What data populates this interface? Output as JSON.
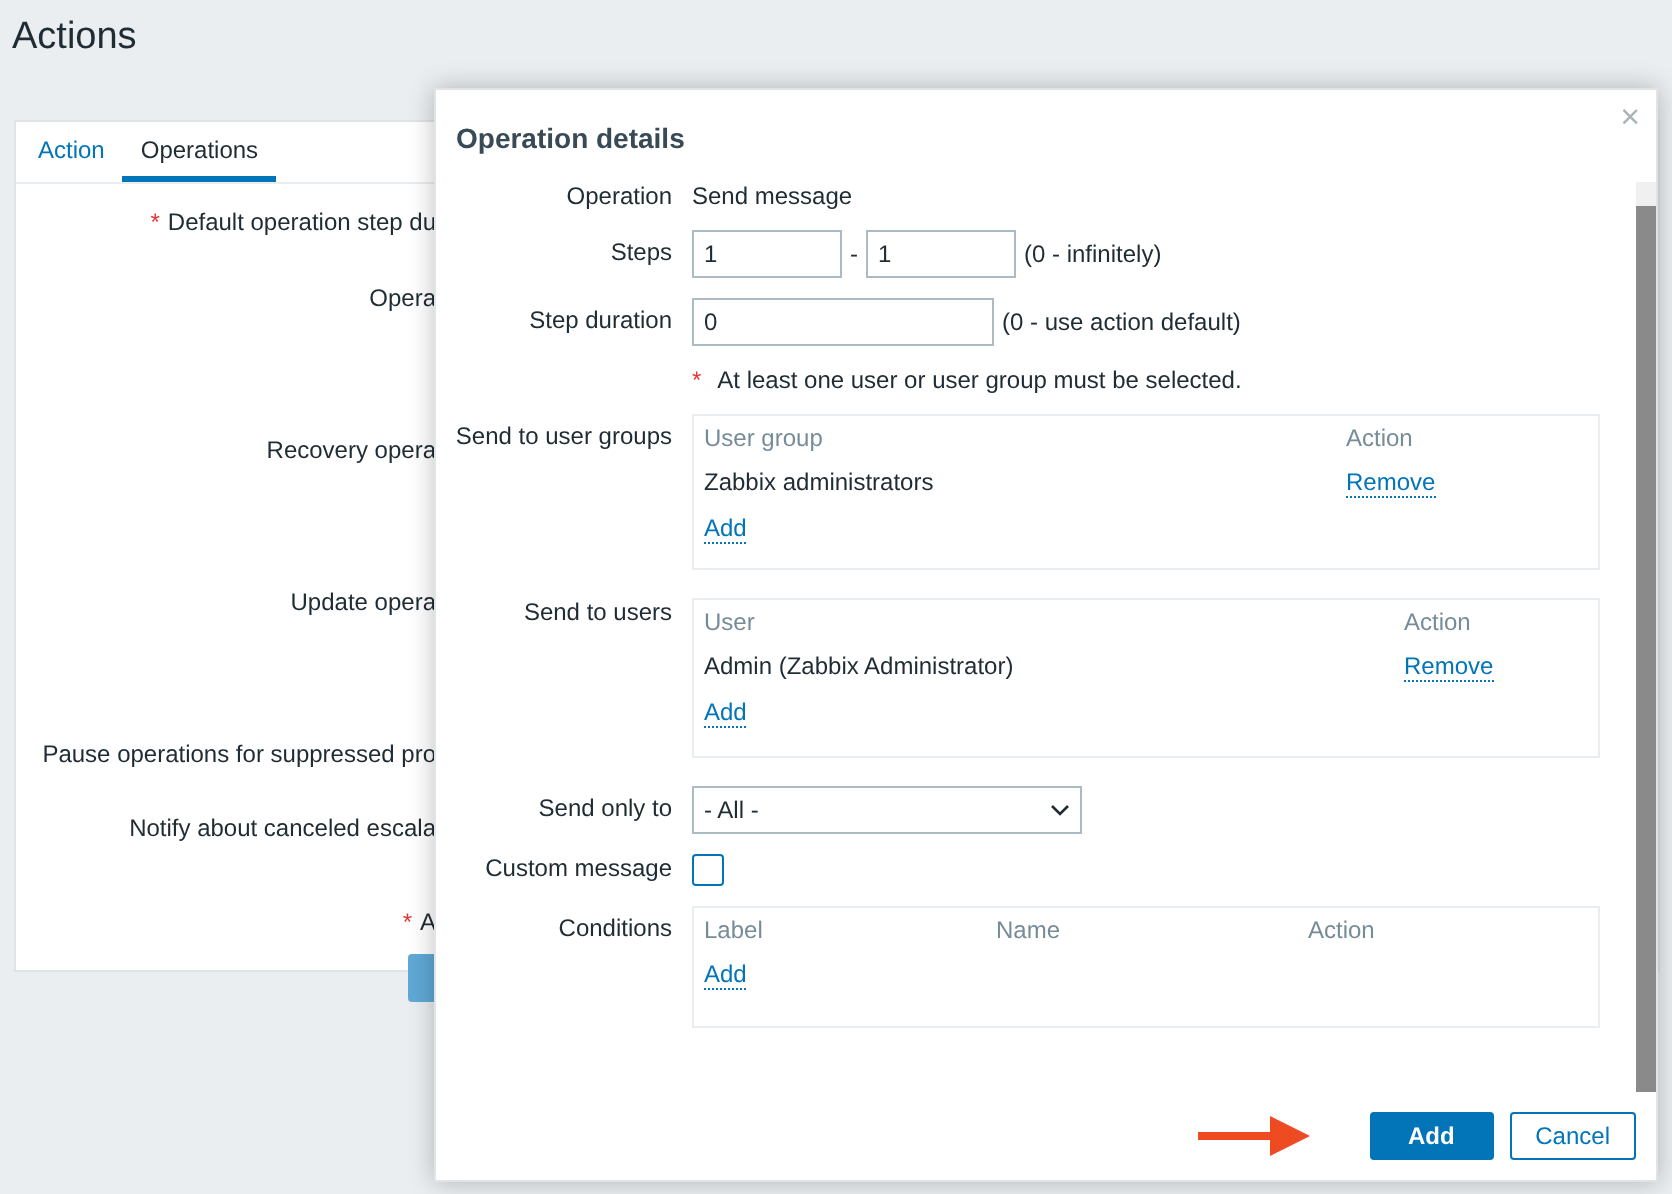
{
  "page_title": "Actions",
  "tabs": [
    {
      "label": "Action",
      "selected": false
    },
    {
      "label": "Operations",
      "selected": true
    }
  ],
  "background_labels": [
    {
      "text": "Default operation step du",
      "mark": "*"
    },
    {
      "text": "Opera"
    },
    {
      "text": "Recovery opera"
    },
    {
      "text": "Update opera"
    },
    {
      "text": "Pause operations for suppressed pro"
    },
    {
      "text": "Notify about canceled escala"
    },
    {
      "text": "A",
      "mark": "*"
    }
  ],
  "dialog": {
    "title": "Operation details",
    "close": "×",
    "operation": {
      "label": "Operation",
      "value": "Send message"
    },
    "steps": {
      "label": "Steps",
      "from": "1",
      "separator": "-",
      "to": "1",
      "hint": "(0 - infinitely)"
    },
    "step_duration": {
      "label": "Step duration",
      "value": "0",
      "hint": "(0 - use action default)"
    },
    "notice_mark": "*",
    "notice": "At least one user or user group must be selected.",
    "tables": [
      {
        "label": "Send to user groups",
        "columns": [
          "User group",
          "Action"
        ],
        "rows": [
          [
            "Zabbix administrators",
            "Remove"
          ]
        ],
        "add": "Add"
      },
      {
        "label": "Send to users",
        "columns": [
          "User",
          "Action"
        ],
        "rows": [
          [
            "Admin (Zabbix Administrator)",
            "Remove"
          ]
        ],
        "add": "Add"
      }
    ],
    "send_only_to": {
      "label": "Send only to",
      "value": "- All -"
    },
    "custom_message": {
      "label": "Custom message",
      "checked": false
    },
    "conditions": {
      "label": "Conditions",
      "columns": [
        "Label",
        "Name",
        "Action"
      ],
      "add": "Add"
    },
    "buttons": [
      {
        "label": "Add",
        "kind": "primary"
      },
      {
        "label": "Cancel",
        "kind": "secondary"
      }
    ]
  }
}
